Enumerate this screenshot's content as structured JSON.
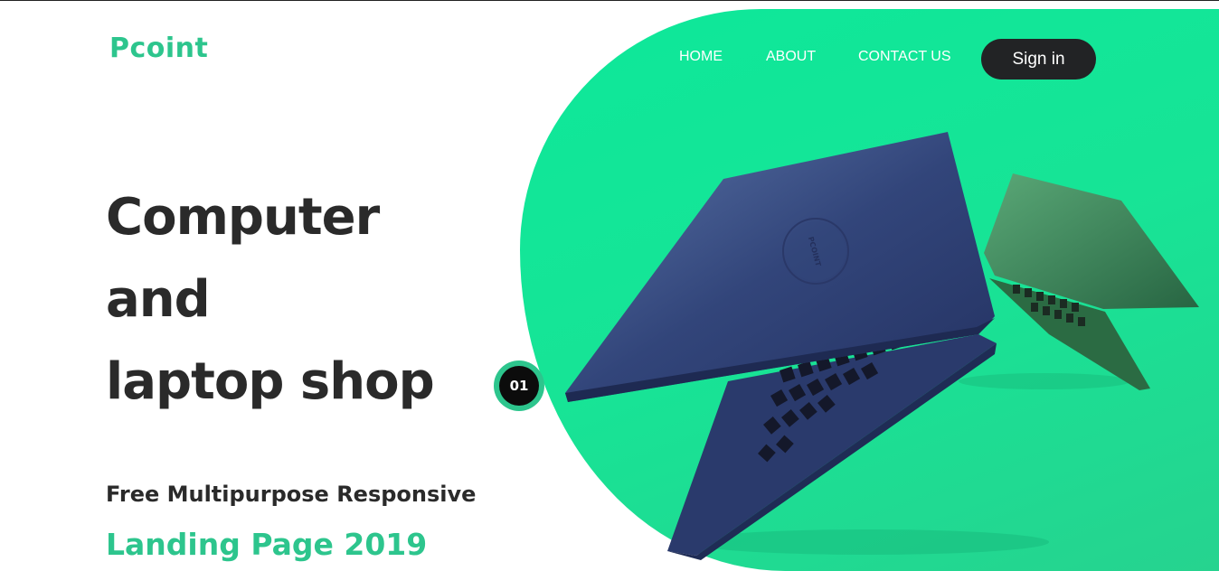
{
  "brand": {
    "logo_text": "Pcoint"
  },
  "nav": {
    "items": [
      {
        "label": "HOME"
      },
      {
        "label": "ABOUT"
      },
      {
        "label": "CONTACT US"
      }
    ],
    "signin_label": "Sign in"
  },
  "hero": {
    "title_lines": [
      "Computer",
      "and",
      "laptop shop"
    ],
    "subtitle": "Free Multipurpose Responsive",
    "subtitle_highlight": "Landing Page 2019",
    "slide_number": "01",
    "product_emblem": "PCOINT"
  },
  "colors": {
    "accent": "#2dc58d",
    "hero_green": "#0de89a",
    "dark": "#222325",
    "laptop_blue": "#2e3e6e",
    "laptop_green": "#2f7a4c"
  },
  "icons": [
    "laptop-image-blue",
    "laptop-image-green"
  ]
}
